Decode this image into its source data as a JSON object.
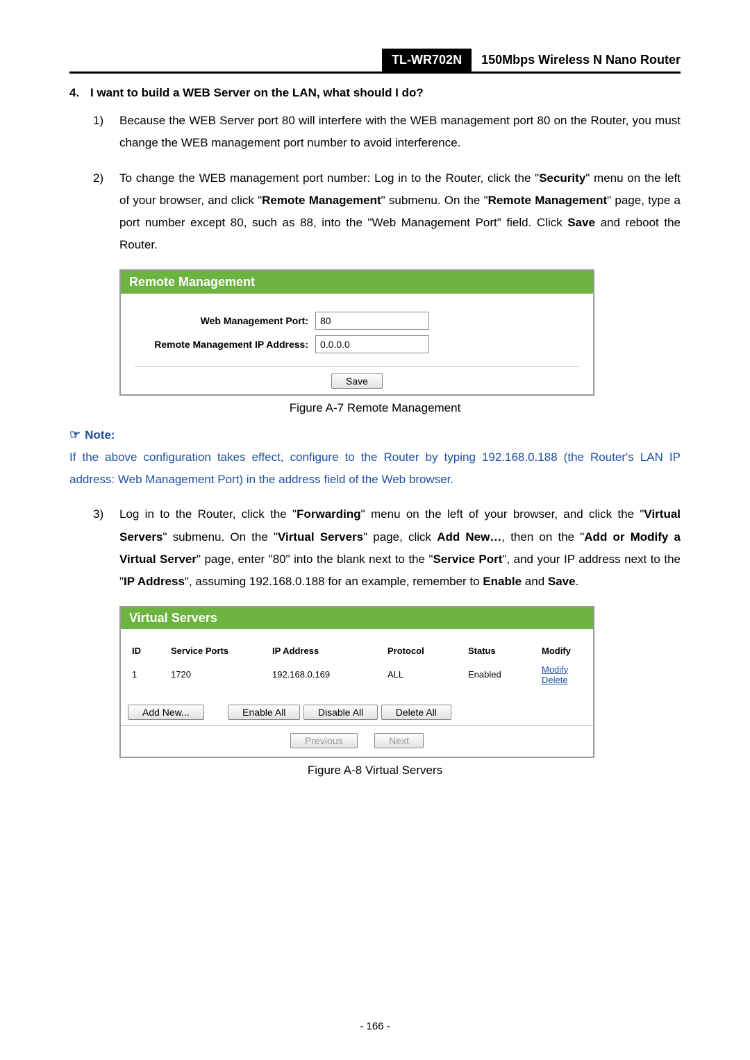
{
  "header": {
    "model": "TL-WR702N",
    "title": "150Mbps Wireless N Nano Router"
  },
  "section": {
    "number": "4.",
    "title": "I want to build a WEB Server on the LAN, what should I do?"
  },
  "items": {
    "i1": {
      "bullet": "1)",
      "text": "Because the WEB Server port 80 will interfere with the WEB management port 80 on the Router, you must change the WEB management port number to avoid interference."
    },
    "i2": {
      "bullet": "2)",
      "p1": "To change the WEB management port number: Log in to the Router, click the \"",
      "b1": "Security",
      "p2": "\" menu on the left of your browser, and click \"",
      "b2": "Remote Management",
      "p3": "\" submenu. On the \"",
      "b3": "Remote Management",
      "p4": "\" page, type a port number except 80, such as 88, into the \"Web Management Port\" field. Click ",
      "b4": "Save",
      "p5": " and reboot the Router."
    },
    "i3": {
      "bullet": "3)",
      "p1": "Log in to the Router, click the \"",
      "b1": "Forwarding",
      "p2": "\" menu on the left of your browser, and click the \"",
      "b2": "Virtual Servers",
      "p3": "\" submenu. On the \"",
      "b3": "Virtual Servers",
      "p4": "\" page, click ",
      "b4": "Add New…",
      "p5": ", then on the \"",
      "b5": "Add or Modify a Virtual Server",
      "p6": "\" page, enter \"80\" into the blank next to the \"",
      "b6": "Service Port",
      "p7": "\", and your IP address next to the \"",
      "b7": "IP Address",
      "p8": "\", assuming 192.168.0.188 for an example, remember to ",
      "b8": "Enable",
      "p9": " and ",
      "b9": "Save",
      "p10": "."
    }
  },
  "fig_a7": {
    "title": "Remote Management",
    "label_port": "Web Management Port:",
    "value_port": "80",
    "label_ip": "Remote Management IP Address:",
    "value_ip": "0.0.0.0",
    "save": "Save",
    "caption": "Figure A-7    Remote Management"
  },
  "note": {
    "label": "Note:",
    "body": "If the above configuration takes effect, configure to the Router by typing 192.168.0.188 (the Router's LAN IP address: Web Management Port) in the address field of the Web browser."
  },
  "fig_a8": {
    "title": "Virtual Servers",
    "headers": {
      "id": "ID",
      "ports": "Service Ports",
      "ip": "IP Address",
      "proto": "Protocol",
      "status": "Status",
      "modify": "Modify"
    },
    "row": {
      "id": "1",
      "ports": "1720",
      "ip": "192.168.0.169",
      "proto": "ALL",
      "status": "Enabled",
      "modify": "Modify",
      "delete": "Delete"
    },
    "buttons": {
      "add": "Add New...",
      "enable": "Enable All",
      "disable": "Disable All",
      "delete": "Delete All",
      "prev": "Previous",
      "next": "Next"
    },
    "caption": "Figure A-8    Virtual Servers"
  },
  "page_number": "- 166 -"
}
